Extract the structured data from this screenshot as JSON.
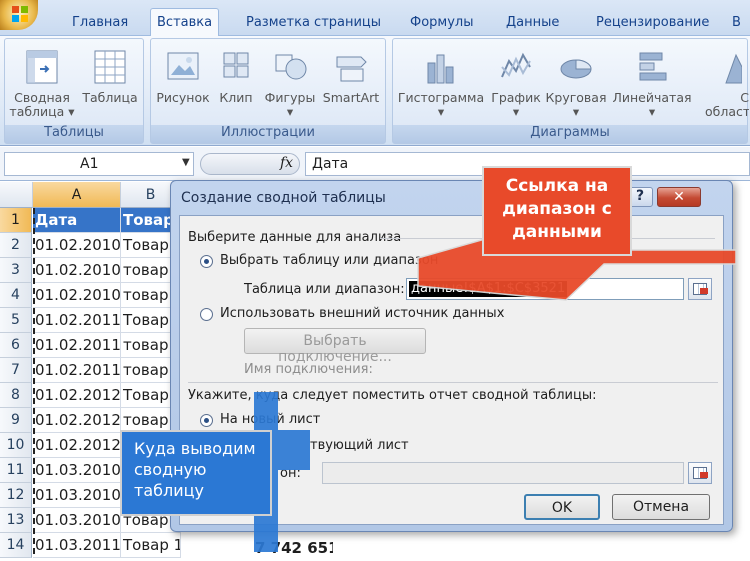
{
  "ribbon": {
    "tabs": [
      "Главная",
      "Вставка",
      "Разметка страницы",
      "Формулы",
      "Данные",
      "Рецензирование",
      "В"
    ],
    "active_tab": "Вставка",
    "groups": {
      "tables": {
        "label": "Таблицы",
        "buttons": [
          {
            "line1": "Сводная",
            "line2": "таблица ▾",
            "icon": "pivot-table-icon"
          },
          {
            "line1": "Таблица",
            "line2": "",
            "icon": "table-icon"
          }
        ]
      },
      "illustrations": {
        "label": "Иллюстрации",
        "buttons": [
          {
            "line1": "Рисунок",
            "icon": "picture-icon"
          },
          {
            "line1": "Клип",
            "icon": "clip-art-icon"
          },
          {
            "line1": "Фигуры",
            "line2": "▾",
            "icon": "shapes-icon"
          },
          {
            "line1": "SmartArt",
            "icon": "smartart-icon"
          }
        ]
      },
      "charts": {
        "label": "Диаграммы",
        "buttons": [
          {
            "line1": "Гистограмма",
            "line2": "▾",
            "icon": "column-chart-icon"
          },
          {
            "line1": "График",
            "line2": "▾",
            "icon": "line-chart-icon"
          },
          {
            "line1": "Круговая",
            "line2": "▾",
            "icon": "pie-chart-icon"
          },
          {
            "line1": "Линейчатая",
            "line2": "▾",
            "icon": "bar-chart-icon"
          },
          {
            "line1": "С",
            "line2": "областя",
            "icon": "area-chart-icon"
          }
        ]
      }
    }
  },
  "formula_bar": {
    "name_box": "A1",
    "fx": "fx",
    "formula": "Дата"
  },
  "sheet": {
    "columns": [
      "A",
      "B"
    ],
    "rows": [
      {
        "num": "1",
        "a": "Дата",
        "b": "Товар"
      },
      {
        "num": "2",
        "a": "01.02.2010",
        "b": "Товар"
      },
      {
        "num": "3",
        "a": "01.02.2010",
        "b": "товар"
      },
      {
        "num": "4",
        "a": "01.02.2010",
        "b": "товар"
      },
      {
        "num": "5",
        "a": "01.02.2011",
        "b": "Товар"
      },
      {
        "num": "6",
        "a": "01.02.2011",
        "b": "товар"
      },
      {
        "num": "7",
        "a": "01.02.2011",
        "b": "товар"
      },
      {
        "num": "8",
        "a": "01.02.2012",
        "b": "Товар"
      },
      {
        "num": "9",
        "a": "01.02.2012",
        "b": "товар"
      },
      {
        "num": "10",
        "a": "01.02.2012",
        "b": "товар"
      },
      {
        "num": "11",
        "a": "01.03.2010",
        "b": "Товар"
      },
      {
        "num": "12",
        "a": "01.03.2010",
        "b": "товар"
      },
      {
        "num": "13",
        "a": "01.03.2010",
        "b": "товар"
      },
      {
        "num": "14",
        "a": "01.03.2011",
        "b": "Товар 1"
      }
    ],
    "partial_value": "7 742 651"
  },
  "dialog": {
    "title": "Создание сводной таблицы",
    "help": "?",
    "close": "✕",
    "section1": "Выберите данные для анализа",
    "opt_select_table": "Выбрать таблицу или диапазон",
    "table_range_label": "Таблица или диапазон:",
    "table_range_value": "данные!$A$1:$C$3521",
    "opt_external": "Использовать внешний источник данных",
    "choose_connection": "Выбрать подключение...",
    "connection_name": "Имя подключения:",
    "section2": "Укажите, куда следует поместить отчет сводной таблицы:",
    "opt_new_sheet": "На новый лист",
    "opt_existing_visible": "твующий лист",
    "range_label_visible": "он:",
    "ok": "OK",
    "cancel": "Отмена"
  },
  "callouts": {
    "top": [
      "Ссылка на",
      "диапазон с",
      "данными"
    ],
    "left": [
      "Куда выводим",
      "сводную",
      "таблицу"
    ]
  },
  "colors": {
    "callout_red": "#e84a2a",
    "callout_blue": "#2b78d4",
    "header_cell": "#3674c8"
  }
}
